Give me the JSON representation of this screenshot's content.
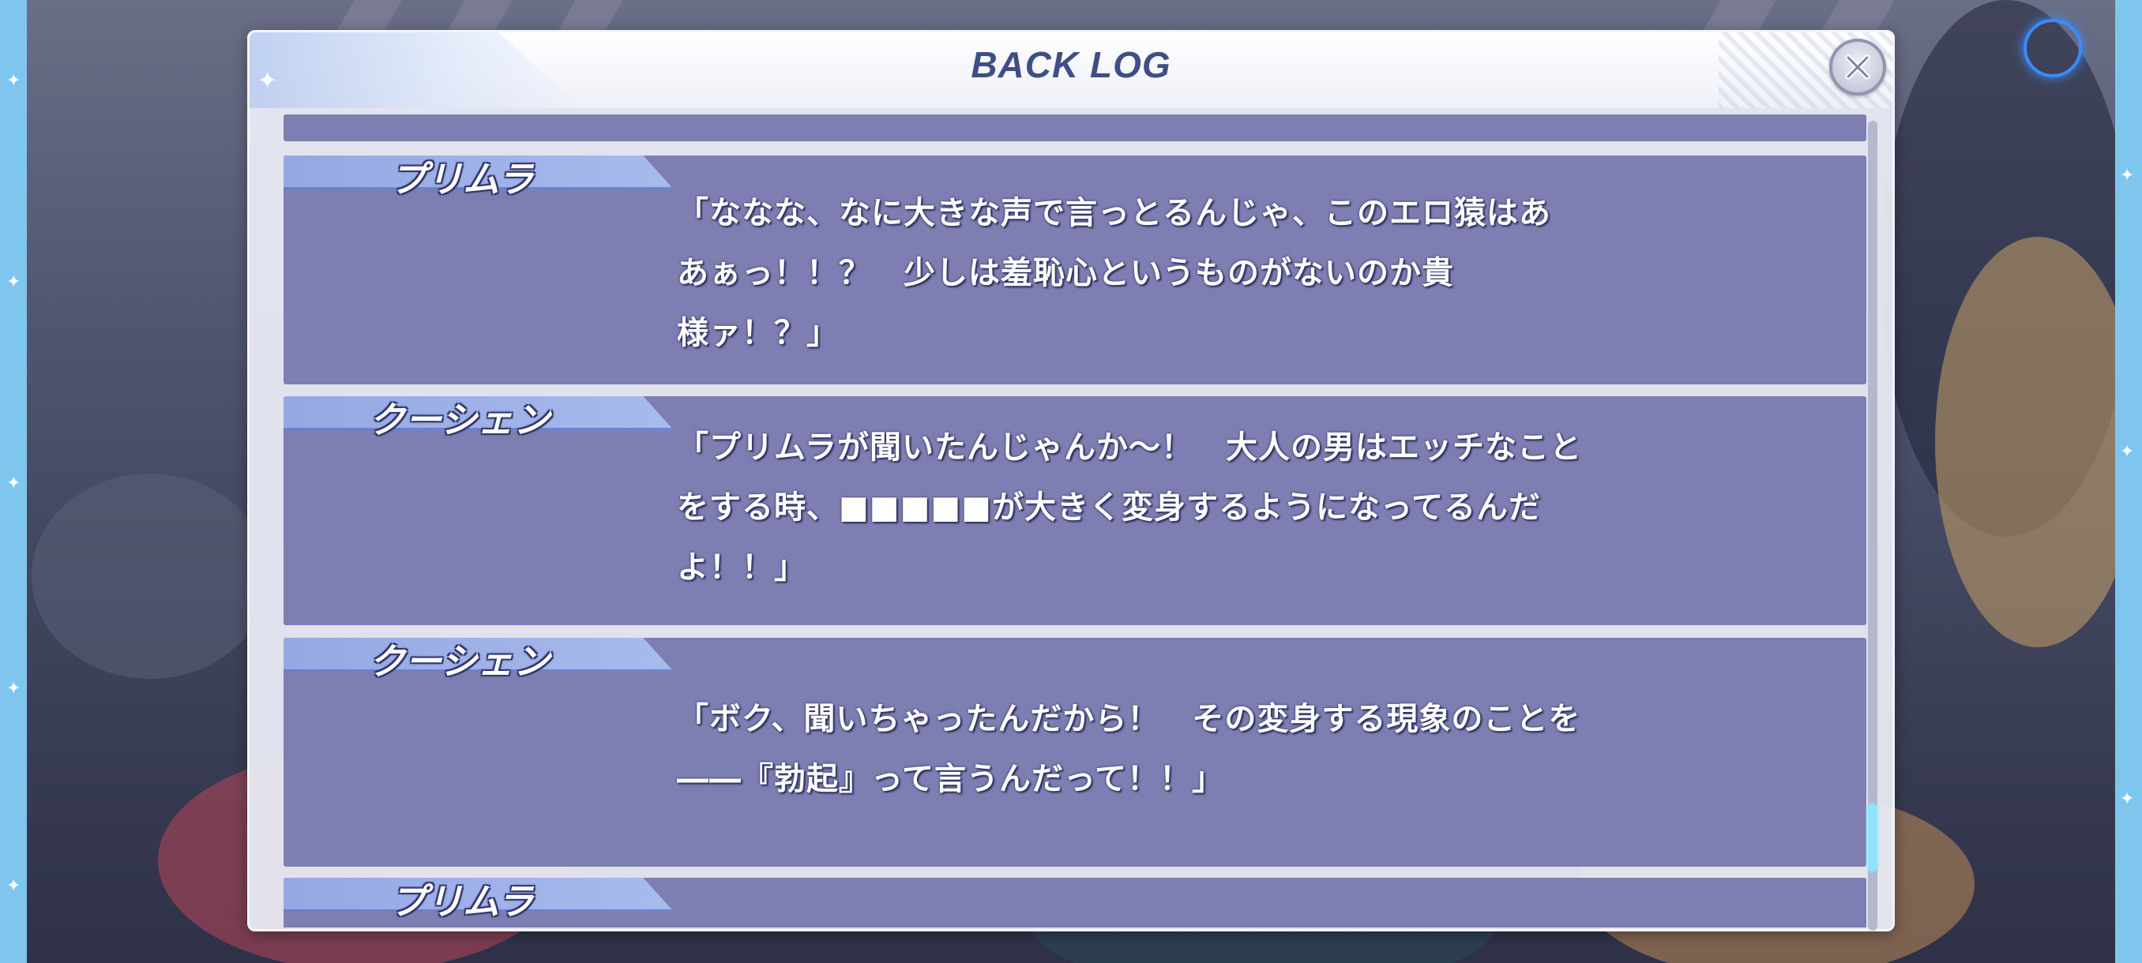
{
  "window": {
    "title": "BACK LOG",
    "close_icon": "close-x-icon"
  },
  "entries": [
    {
      "speaker": "",
      "lines": []
    },
    {
      "speaker": "プリムラ",
      "lines": [
        "「ななな、なに大きな声で言っとるんじゃ、このエロ猿はあ",
        "あぁっ！！？　少しは羞恥心というものがないのか貴",
        "様ァ！？」"
      ]
    },
    {
      "speaker": "クーシェン",
      "lines": [
        "「プリムラが聞いたんじゃんか～！　大人の男はエッチなこと",
        "をする時、■■■■■が大きく変身するようになってるんだ",
        "よ！！」"
      ]
    },
    {
      "speaker": "クーシェン",
      "lines": [
        "「ボク、聞いちゃったんだから！　その変身する現象のことを",
        "――『勃起』って言うんだって！！」"
      ]
    },
    {
      "speaker": "プリムラ",
      "lines": []
    }
  ],
  "scroll": {
    "position_fraction": 0.92
  },
  "colors": {
    "title": "#3f4f86",
    "entry_bg": "#706faa",
    "scroll_thumb": "#8fe3ff",
    "frame": "#7fc6ee"
  }
}
